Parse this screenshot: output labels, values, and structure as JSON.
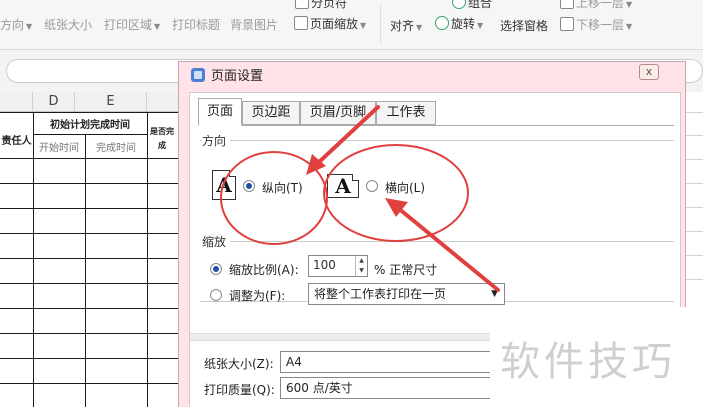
{
  "ribbon": {
    "top_item": "分页符",
    "items": {
      "orientation": "方向",
      "paper_size": "纸张大小",
      "print_area": "打印区域",
      "print_titles": "打印标题",
      "background": "背景图片",
      "page_zoom": "页面缩放",
      "align": "对齐",
      "group": "组合",
      "rotate": "旋转",
      "selection_pane": "选择窗格",
      "send_backward": "下移一层",
      "bring_forward": "上移一层"
    }
  },
  "sheet": {
    "columns": [
      "D",
      "E"
    ],
    "cells": {
      "responsible": "责任人",
      "initial_plan": "初始计划完成时间",
      "start_time": "开始时间",
      "finish_time": "完成时间",
      "is_done": "是否完成"
    }
  },
  "dialog": {
    "title": "页面设置",
    "close_label": "x",
    "tabs": [
      "页面",
      "页边距",
      "页眉/页脚",
      "工作表"
    ],
    "active_tab": 0,
    "orientation": {
      "section_label": "方向",
      "paper_glyph": "A",
      "portrait_label": "纵向(T)",
      "landscape_label": "横向(L)",
      "selected": "portrait"
    },
    "scaling": {
      "section_label": "缩放",
      "zoom_label": "缩放比例(A):",
      "zoom_value": "100",
      "zoom_suffix": "% 正常尺寸",
      "fit_label": "调整为(F):",
      "fit_option": "将整个工作表打印在一页",
      "selected": "zoom"
    },
    "paper_size_label": "纸张大小(Z):",
    "paper_size_value": "A4",
    "print_quality_label": "打印质量(Q):",
    "print_quality_value": "600 点/英寸"
  },
  "watermark": "软件技巧",
  "annotation_color": "#e0413e"
}
